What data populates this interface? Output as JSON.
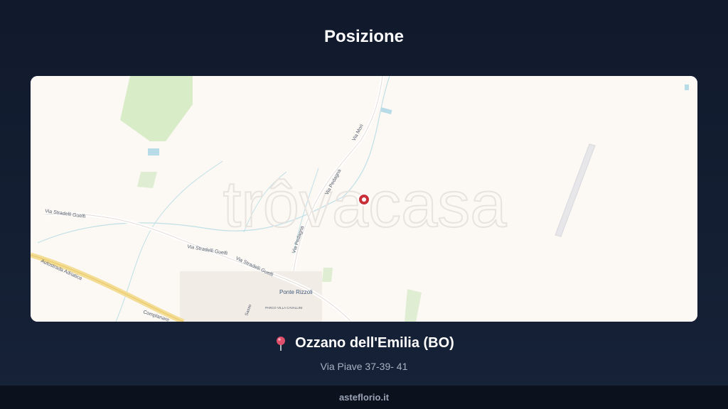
{
  "header": {
    "title": "Posizione"
  },
  "map": {
    "watermark": "trôvacasa",
    "labels": {
      "via_stradelli_guelfi_1": "Via Stradelli Guelfi",
      "via_stradelli_guelfi_2": "Via Stradelli Guelfi",
      "via_stradelli_guelfi_3": "Via Stradelli Guelfi",
      "via_pedagna_1": "Via Pedagna",
      "via_pedagna_2": "Via Pedagna",
      "via_mori": "Via Mori",
      "autostrada": "Autostrada Adriatica",
      "complanare": "Complanare",
      "ponte_rizzoli": "Ponte Rizzoli",
      "parco": "PARCO VILLA CAVALLINI",
      "sasso": "Sasso"
    },
    "colors": {
      "background": "#fcf8f4",
      "green": "#d9ecc8",
      "water": "#b8dbe8",
      "marker": "#c8303a"
    }
  },
  "location": {
    "city": "Ozzano dell'Emilia (BO)",
    "address": "Via Piave 37-39- 41",
    "icon": "map-pin-icon"
  },
  "footer": {
    "brand": "asteflorio.it"
  }
}
